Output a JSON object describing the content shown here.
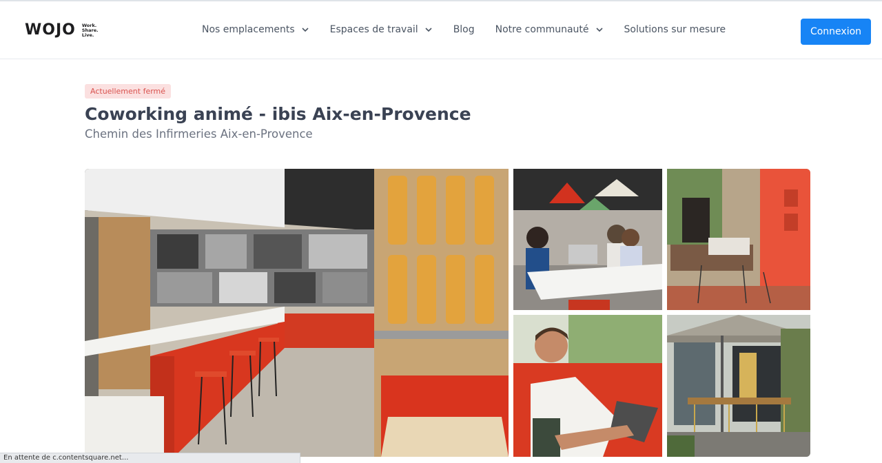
{
  "header": {
    "logo": {
      "word": "WOJO",
      "tagline": [
        "Work.",
        "Share.",
        "Live."
      ]
    },
    "nav": [
      {
        "label": "Nos emplacements",
        "dropdown": true
      },
      {
        "label": "Espaces de travail",
        "dropdown": true
      },
      {
        "label": "Blog",
        "dropdown": false
      },
      {
        "label": "Notre communauté",
        "dropdown": true
      },
      {
        "label": "Solutions sur mesure",
        "dropdown": false
      }
    ],
    "login_label": "Connexion"
  },
  "listing": {
    "status_badge": "Actuellement fermé",
    "title": "Coworking animé - ibis Aix-en-Provence",
    "address": "Chemin des Infirmeries Aix-en-Provence"
  },
  "gallery": {
    "photos": [
      "coworking-bar-interior",
      "pendant-lamps-meeting-table",
      "lounge-sofas",
      "man-laptop-red-sofa",
      "terrace-umbrella"
    ]
  },
  "statusbar": {
    "text": "En attente de c.contentsquare.net..."
  },
  "colors": {
    "accent": "#1784f5",
    "badge_bg": "#fbe0e0",
    "badge_text": "#d9534f",
    "title": "#3a4253"
  }
}
